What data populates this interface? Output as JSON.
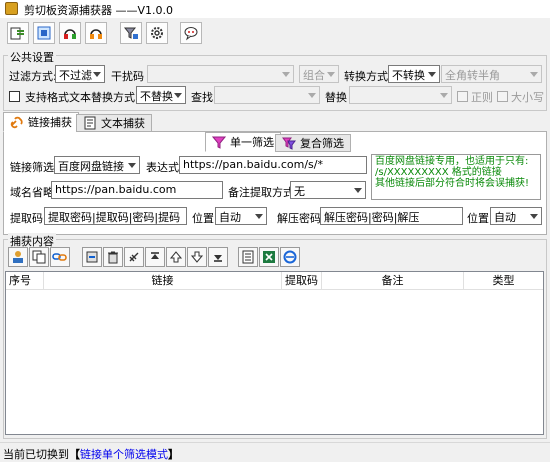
{
  "window": {
    "title": "剪切板资源捕获器      ——V1.0.0"
  },
  "toolbar": {
    "buttons": [
      {
        "name": "capture-toggle-icon"
      },
      {
        "name": "screen-capture-icon"
      },
      {
        "name": "headset-red-icon"
      },
      {
        "name": "headset-orange-icon"
      },
      {
        "name": "filter-icon"
      },
      {
        "name": "gear-icon"
      },
      {
        "name": "chat-bubble-icon"
      }
    ]
  },
  "public_settings": {
    "legend": "公共设置",
    "filter_label": "过滤方式:",
    "filter_value": "不过滤",
    "noise_label": "干扰码",
    "combo_value": "组合",
    "convert_label": "转换方式:",
    "convert_value": "不转换",
    "width_value": "全角转半角",
    "formatted_text_label": "支持格式文本",
    "replace_label": "替换方式:",
    "replace_value": "不替换",
    "find_label": "查找",
    "replace_with_label": "替换",
    "regex_label": "正则",
    "case_label": "大小写"
  },
  "tabs": [
    {
      "label": "链接捕获",
      "selected": true
    },
    {
      "label": "文本捕获",
      "selected": false
    }
  ],
  "subtabs": [
    {
      "label": "单一筛选",
      "selected": true
    },
    {
      "label": "复合筛选",
      "selected": false
    }
  ],
  "link_capture": {
    "filter_label": "链接筛选",
    "filter_value": "百度网盘链接",
    "expr_label": "表达式",
    "expr_value": "https://pan.baidu.com/s/*",
    "note_lines": [
      "百度网盘链接专用，也适用于只有:",
      "/s/XXXXXXXXX 格式的链接",
      "其他链接后部分符合时将会误捕获!"
    ],
    "domain_label": "域名省略",
    "domain_value": "https://pan.baidu.com",
    "remark_label": "备注提取方式",
    "remark_value": "无",
    "code_label": "提取码",
    "code_value": "提取密码|提取码|密码|提码",
    "position_label": "位置",
    "position_value": "自动",
    "unzip_label": "解压密码",
    "unzip_value": "解压密码|密码|解压",
    "position2_label": "位置",
    "position2_value": "自动"
  },
  "capture_content": {
    "legend": "捕获内容",
    "columns": [
      "序号",
      "链接",
      "提取码",
      "备注",
      "类型"
    ],
    "rows": []
  },
  "status": {
    "prefix": "当前已切换到",
    "open_bracket": "【",
    "mode": "链接单个筛选模式",
    "close_bracket": "】"
  },
  "colors": {
    "accent_green": "#0a8a0a",
    "status_blue": "#0000ee",
    "selected_tab": "#ffffff"
  }
}
